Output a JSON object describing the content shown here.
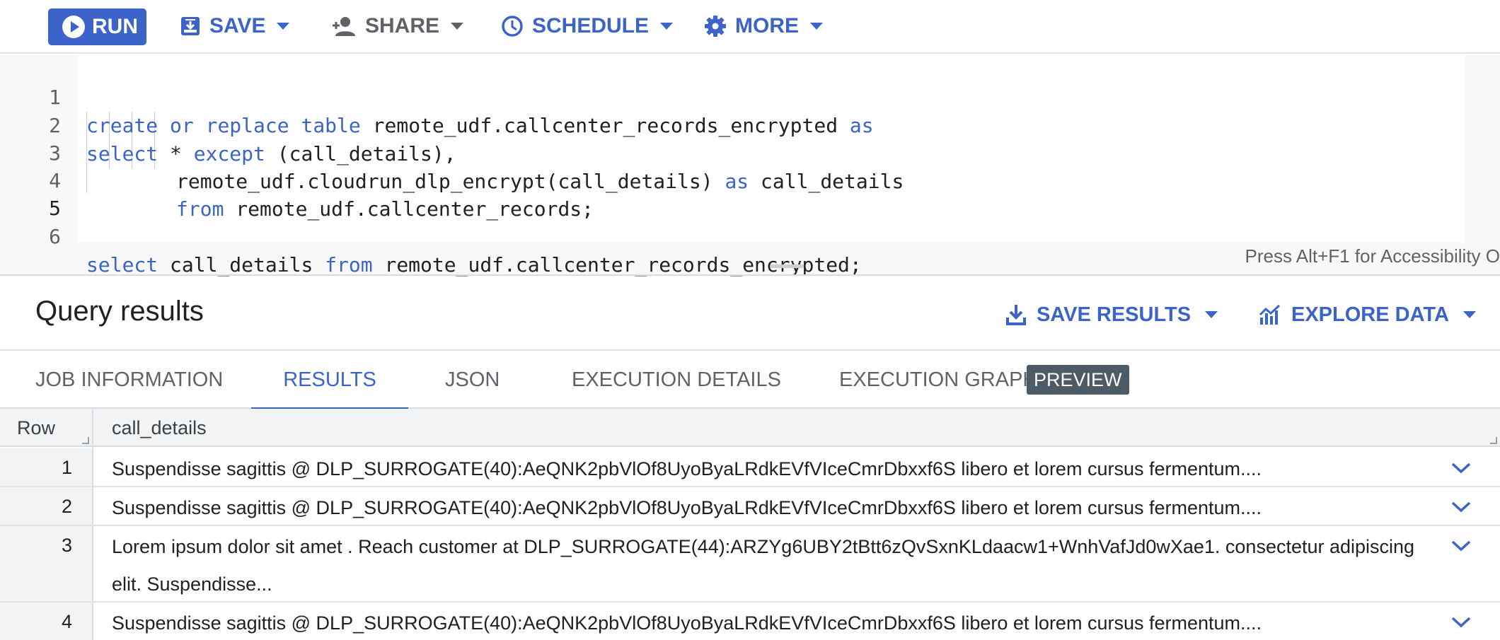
{
  "toolbar": {
    "run_label": "RUN",
    "save_label": "SAVE",
    "share_label": "SHARE",
    "schedule_label": "SCHEDULE",
    "more_label": "MORE"
  },
  "editor": {
    "lines": [
      {
        "num": "1",
        "text": "create or replace table remote_udf.callcenter_records_encrypted as"
      },
      {
        "num": "2",
        "text": "select * except (call_details),"
      },
      {
        "num": "3",
        "text": "remote_udf.cloudrun_dlp_encrypt(call_details) as call_details"
      },
      {
        "num": "4",
        "text": "from remote_udf.callcenter_records;"
      },
      {
        "num": "5",
        "text": ""
      },
      {
        "num": "6",
        "text": "select call_details from remote_udf.callcenter_records_encrypted;"
      }
    ],
    "accessibility_hint": "Press Alt+F1 for Accessibility O"
  },
  "results": {
    "title": "Query results",
    "save_results_label": "SAVE RESULTS",
    "explore_data_label": "EXPLORE DATA",
    "tabs": [
      {
        "label": "JOB INFORMATION",
        "active": false
      },
      {
        "label": "RESULTS",
        "active": true
      },
      {
        "label": "JSON",
        "active": false
      },
      {
        "label": "EXECUTION DETAILS",
        "active": false
      },
      {
        "label": "EXECUTION GRAPH",
        "active": false
      }
    ],
    "preview_badge": "PREVIEW",
    "columns": [
      "Row",
      "call_details"
    ],
    "rows": [
      {
        "row": "1",
        "call_details": "Suspendisse sagittis @ DLP_SURROGATE(40):AeQNK2pbVlOf8UyoByaLRdkEVfVIceCmrDbxxf6S libero et lorem cursus fermentum...."
      },
      {
        "row": "2",
        "call_details": "Suspendisse sagittis @ DLP_SURROGATE(40):AeQNK2pbVlOf8UyoByaLRdkEVfVIceCmrDbxxf6S libero et lorem cursus fermentum...."
      },
      {
        "row": "3",
        "call_details": "Lorem ipsum dolor sit amet . Reach customer at DLP_SURROGATE(44):ARZYg6UBY2tBtt6zQvSxnKLdaacw1+WnhVafJd0wXae1. consectetur adipiscing elit. Suspendisse..."
      },
      {
        "row": "4",
        "call_details": "Suspendisse sagittis @ DLP_SURROGATE(40):AeQNK2pbVlOf8UyoByaLRdkEVfVIceCmrDbxxf6S libero et lorem cursus fermentum...."
      }
    ]
  },
  "colors": {
    "accent": "#3b63c8",
    "badge": "#4d5b66"
  },
  "icons": [
    "play-icon",
    "save-icon",
    "person-add-icon",
    "clock-icon",
    "gear-icon",
    "download-icon",
    "chart-icon",
    "chevron-down-icon"
  ]
}
